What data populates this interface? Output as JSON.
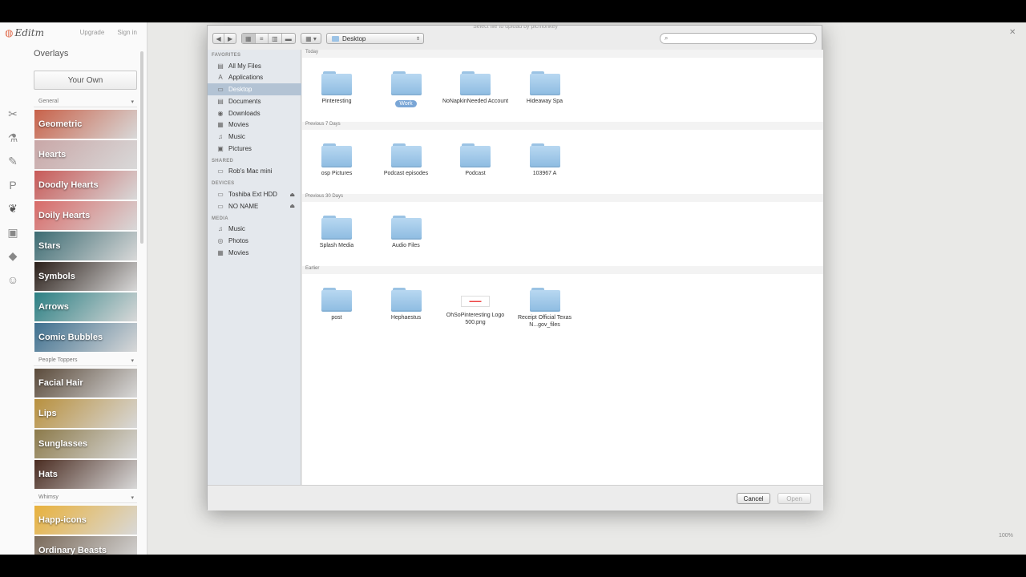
{
  "editor": {
    "logo": "Editm",
    "upgrade": "Upgrade",
    "signin": "Sign in",
    "panel_title": "Overlays",
    "your_own": "Your Own",
    "categories": [
      "General",
      "People Toppers",
      "Whimsy"
    ],
    "overlays_general": [
      {
        "label": "Geometric",
        "color": "#c8624a"
      },
      {
        "label": "Hearts",
        "color": "#c9a7a7"
      },
      {
        "label": "Doodly Hearts",
        "color": "#c85a58"
      },
      {
        "label": "Doily Hearts",
        "color": "#d86a68"
      },
      {
        "label": "Stars",
        "color": "#3c6b72"
      },
      {
        "label": "Symbols",
        "color": "#2a1f19"
      },
      {
        "label": "Arrows",
        "color": "#2b7f83"
      },
      {
        "label": "Comic Bubbles",
        "color": "#3d6f8f"
      }
    ],
    "overlays_people": [
      {
        "label": "Facial Hair",
        "color": "#5a4a3a"
      },
      {
        "label": "Lips",
        "color": "#b8903e"
      },
      {
        "label": "Sunglasses",
        "color": "#8c7a4a"
      },
      {
        "label": "Hats",
        "color": "#4b2d22"
      }
    ],
    "overlays_whimsy": [
      {
        "label": "Happ-icons",
        "color": "#e8b13c"
      },
      {
        "label": "Ordinary Beasts",
        "color": "#7a6a5a"
      }
    ]
  },
  "dialog": {
    "title": "Select file to upload by picmonkey",
    "location": "Desktop",
    "search_placeholder": "",
    "sidebar": {
      "favorites_header": "FAVORITES",
      "favorites": [
        "All My Files",
        "Applications",
        "Desktop",
        "Documents",
        "Downloads",
        "Movies",
        "Music",
        "Pictures"
      ],
      "selected": "Desktop",
      "shared_header": "SHARED",
      "shared": [
        "Rob's Mac mini"
      ],
      "devices_header": "DEVICES",
      "devices": [
        "Toshiba Ext HDD",
        "NO NAME"
      ],
      "media_header": "MEDIA",
      "media": [
        "Music",
        "Photos",
        "Movies"
      ]
    },
    "groups": [
      {
        "header": "Today",
        "items": [
          "Pinteresting",
          "Work",
          "NoNapkinNeeded Account",
          "Hideaway Spa"
        ]
      },
      {
        "header": "Previous 7 Days",
        "items": [
          "osp Pictures",
          "Podcast episodes",
          "Podcast",
          "103967 A"
        ]
      },
      {
        "header": "Previous 30 Days",
        "items": [
          "Splash Media",
          "Audio Files"
        ]
      },
      {
        "header": "Earlier",
        "items": [
          "post",
          "Hephaestus",
          "OhSoPinteresting Logo 500.png",
          "Receipt  Official Texas N...gov_files"
        ]
      }
    ],
    "selected_item": "Work",
    "cancel": "Cancel",
    "open": "Open"
  },
  "zoom": "100%"
}
